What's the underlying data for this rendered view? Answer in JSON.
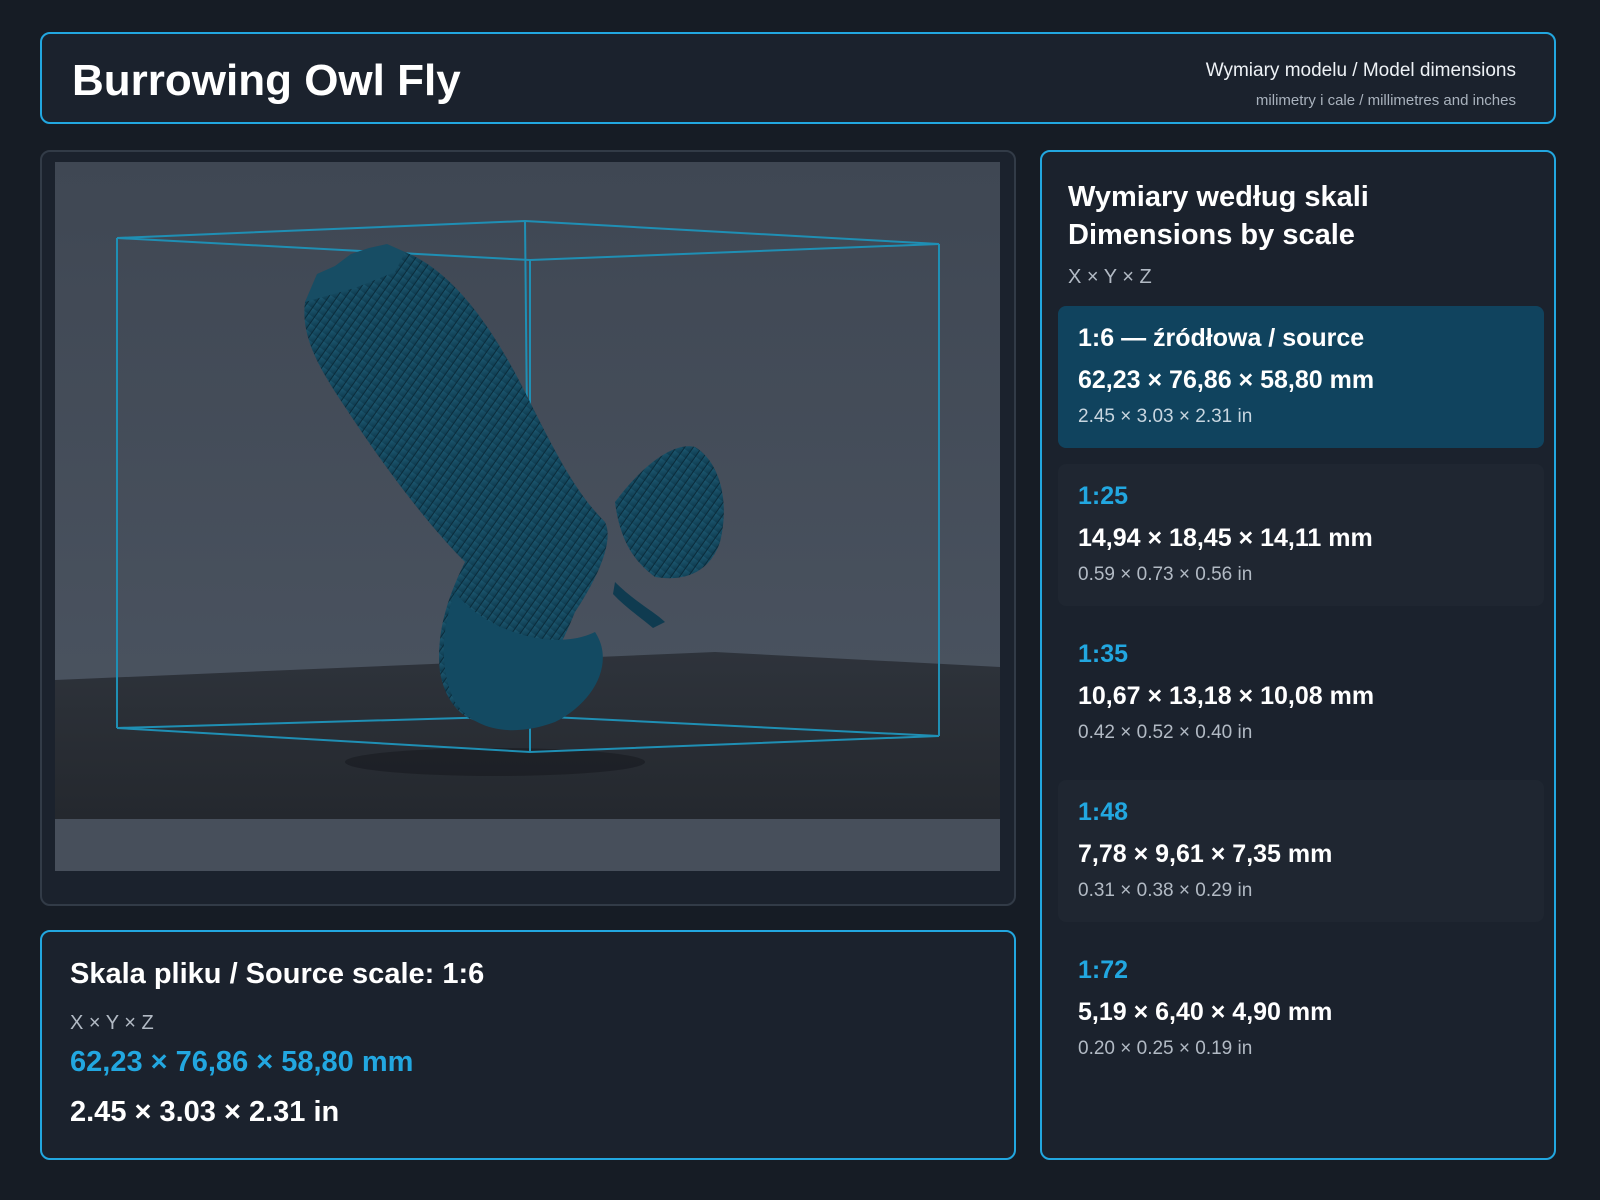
{
  "header": {
    "title": "Burrowing Owl Fly",
    "subtitle": "Wymiary modelu / Model dimensions",
    "units_note": "milimetry i cale / millimetres and inches"
  },
  "viewer": {
    "subject_icon": "owl-model-render",
    "bbox_color": "#22a7e0"
  },
  "source": {
    "title": "Skala pliku / Source scale: 1:6",
    "axes": "X × Y × Z",
    "mm": "62,23 × 76,86 × 58,80 mm",
    "in": "2.45 × 3.03 × 2.31 in"
  },
  "scales": {
    "title_line1": "Wymiary według skali",
    "title_line2": "Dimensions by scale",
    "axes": "X × Y × Z",
    "items": [
      {
        "label": "1:6  —  źródłowa / source",
        "mm": "62,23 × 76,86 × 58,80 mm",
        "in": "2.45 × 3.03 × 2.31 in"
      },
      {
        "label": "1:25",
        "mm": "14,94 × 18,45 × 14,11 mm",
        "in": "0.59 × 0.73 × 0.56 in"
      },
      {
        "label": "1:35",
        "mm": "10,67 × 13,18 × 10,08 mm",
        "in": "0.42 × 0.52 × 0.40 in"
      },
      {
        "label": "1:48",
        "mm": "7,78 × 9,61 × 7,35 mm",
        "in": "0.31 × 0.38 × 0.29 in"
      },
      {
        "label": "1:72",
        "mm": "5,19 × 6,40 × 4,90 mm",
        "in": "0.20 × 0.25 × 0.19 in"
      }
    ]
  },
  "colors": {
    "accent": "#22a7e0",
    "selected_card": "#10435e",
    "background": "#161c25",
    "panel": "#1b222d"
  }
}
